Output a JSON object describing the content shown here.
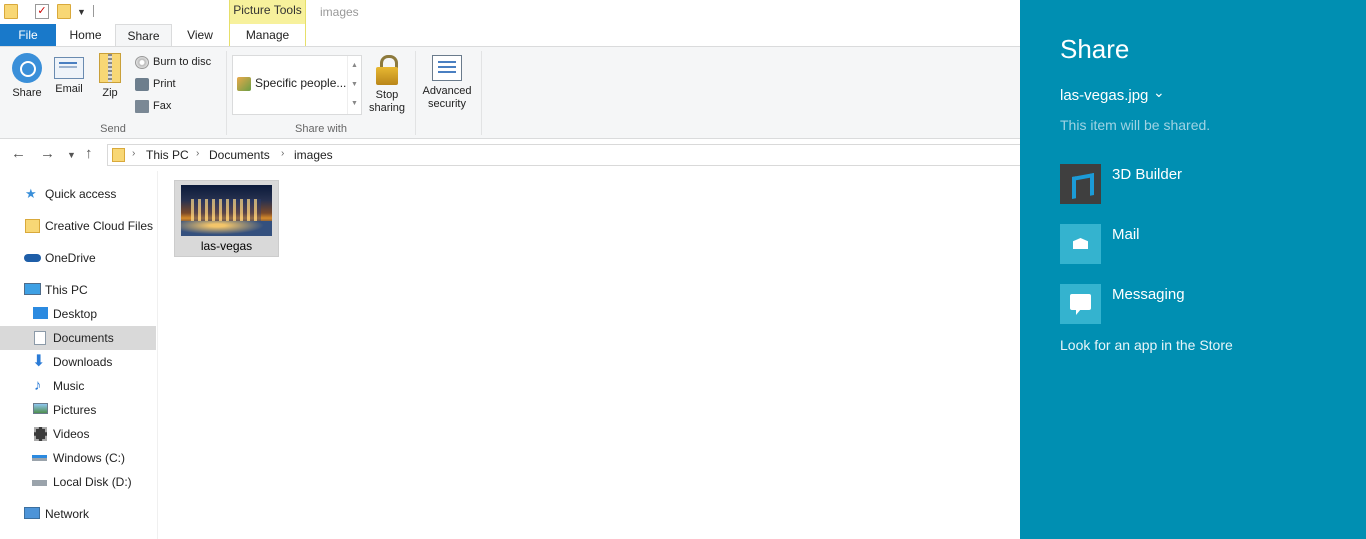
{
  "titlebar": {
    "context_group": "Picture Tools",
    "window_title": "images"
  },
  "tabs": {
    "file": "File",
    "home": "Home",
    "share": "Share",
    "view": "View",
    "manage": "Manage"
  },
  "ribbon": {
    "send": {
      "share": "Share",
      "email": "Email",
      "zip": "Zip",
      "burn": "Burn to disc",
      "print": "Print",
      "fax": "Fax",
      "group_label": "Send"
    },
    "share_with": {
      "specific_people": "Specific people...",
      "group_label": "Share with"
    },
    "stop_sharing": [
      "Stop",
      "sharing"
    ],
    "advanced_security": [
      "Advanced",
      "security"
    ]
  },
  "address": {
    "crumbs": [
      "This PC",
      "Documents",
      "images"
    ]
  },
  "navpane": {
    "quick_access": "Quick access",
    "creative_cloud": "Creative Cloud Files",
    "onedrive": "OneDrive",
    "this_pc": "This PC",
    "desktop": "Desktop",
    "documents": "Documents",
    "downloads": "Downloads",
    "music": "Music",
    "pictures": "Pictures",
    "videos": "Videos",
    "windows_c": "Windows (C:)",
    "local_d": "Local Disk (D:)",
    "network": "Network"
  },
  "content": {
    "file_name": "las-vegas"
  },
  "charm": {
    "title": "Share",
    "file": "las-vegas.jpg",
    "subtitle": "This item will be shared.",
    "apps": [
      "3D Builder",
      "Mail",
      "Messaging"
    ],
    "store_link": "Look for an app in the Store"
  },
  "colors": {
    "charm_bg": "#008fb2",
    "file_tab": "#1979ca",
    "context_tab": "#f7f19c"
  }
}
